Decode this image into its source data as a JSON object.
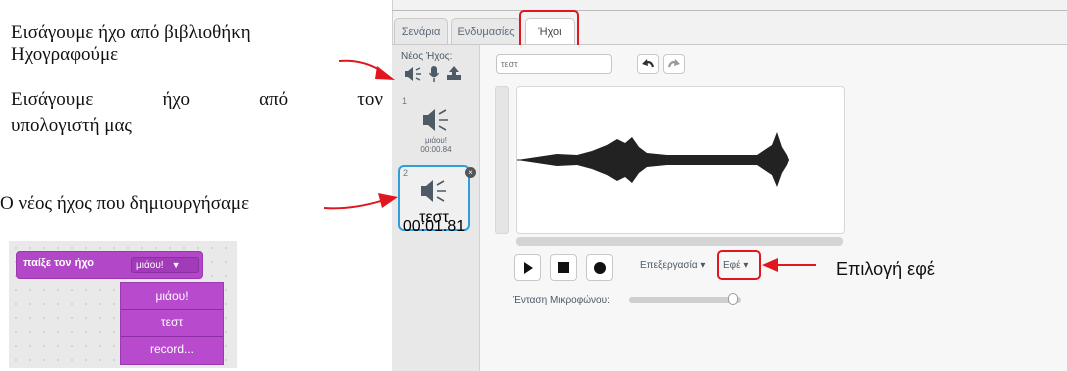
{
  "annotations": {
    "library": "Εισάγουμε ήχο από βιβλιοθήκη",
    "record": "Ηχογραφούμε",
    "upload_words": [
      "Εισάγουμε",
      "ήχο",
      "από",
      "τον"
    ],
    "upload_line2": "υπολογιστή μας",
    "new_sound": "Ο νέος ήχος που δημιουργήσαμε",
    "effect_choice": "Επιλογή εφέ"
  },
  "block": {
    "label": "παίξε τον ήχο",
    "value": "μιάου!",
    "menu": [
      "μιάου!",
      "τεστ",
      "record..."
    ]
  },
  "editor": {
    "tabs": [
      "Σενάρια",
      "Ενδυμασίες",
      "Ήχοι"
    ],
    "active_tab": "Ήχοι",
    "new_sound_label": "Νέος Ήχος:",
    "sound_name_value": "τεστ",
    "sounds": [
      {
        "index": "1",
        "name": "μιάου!",
        "duration": "00:00.84"
      },
      {
        "index": "2",
        "name": "τεστ",
        "duration": "00:01.81"
      }
    ],
    "edit_menu": "Επεξεργασία ▾",
    "effects_menu": "Εφέ ▾",
    "mic_volume_label": "Ένταση Μικροφώνου:",
    "mic_volume": 0.97
  },
  "colors": {
    "highlight": "#e2161e",
    "block_purple": "#b248c8",
    "selected_blue": "#2f9ddb"
  }
}
